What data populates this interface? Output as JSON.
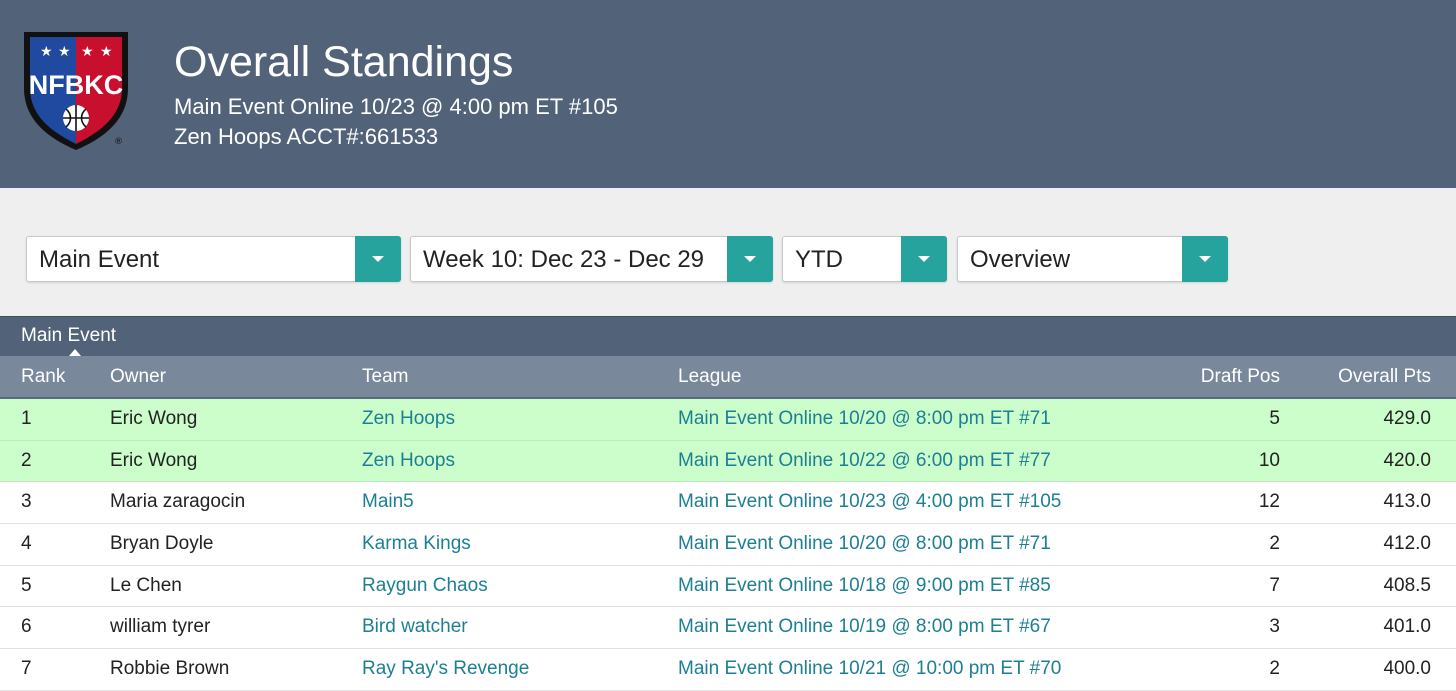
{
  "header": {
    "title": "Overall Standings",
    "subtitle": "Main Event Online 10/23 @ 4:00 pm ET #105",
    "account": "Zen Hoops ACCT#:661533",
    "logo_text": "NFBKC"
  },
  "filters": {
    "event": "Main Event",
    "week": "Week 10: Dec 23 - Dec 29",
    "period": "YTD",
    "view": "Overview"
  },
  "tabs": [
    {
      "label": "Main Event",
      "active": true
    }
  ],
  "table": {
    "columns": [
      "Rank",
      "Owner",
      "Team",
      "League",
      "Draft Pos",
      "Overall Pts"
    ],
    "rows": [
      {
        "rank": "1",
        "owner": "Eric Wong",
        "team": "Zen Hoops",
        "league": "Main Event Online 10/20 @ 8:00 pm ET #71",
        "draft": "5",
        "pts": "429.0",
        "highlight": true
      },
      {
        "rank": "2",
        "owner": "Eric Wong",
        "team": "Zen Hoops",
        "league": "Main Event Online 10/22 @ 6:00 pm ET #77",
        "draft": "10",
        "pts": "420.0",
        "highlight": true
      },
      {
        "rank": "3",
        "owner": "Maria zaragocin",
        "team": "Main5",
        "league": "Main Event Online 10/23 @ 4:00 pm ET #105",
        "draft": "12",
        "pts": "413.0",
        "highlight": false
      },
      {
        "rank": "4",
        "owner": "Bryan Doyle",
        "team": "Karma Kings",
        "league": "Main Event Online 10/20 @ 8:00 pm ET #71",
        "draft": "2",
        "pts": "412.0",
        "highlight": false
      },
      {
        "rank": "5",
        "owner": "Le Chen",
        "team": "Raygun Chaos",
        "league": "Main Event Online 10/18 @ 9:00 pm ET #85",
        "draft": "7",
        "pts": "408.5",
        "highlight": false
      },
      {
        "rank": "6",
        "owner": "william tyrer",
        "team": "Bird watcher",
        "league": "Main Event Online 10/19 @ 8:00 pm ET #67",
        "draft": "3",
        "pts": "401.0",
        "highlight": false
      },
      {
        "rank": "7",
        "owner": "Robbie Brown",
        "team": "Ray Ray's Revenge",
        "league": "Main Event Online 10/21 @ 10:00 pm ET #70",
        "draft": "2",
        "pts": "400.0",
        "highlight": false
      }
    ]
  },
  "colors": {
    "header_bg": "#526279",
    "accent": "#27a39e",
    "highlight_row": "#ccfecb",
    "link": "#1c7f93"
  }
}
